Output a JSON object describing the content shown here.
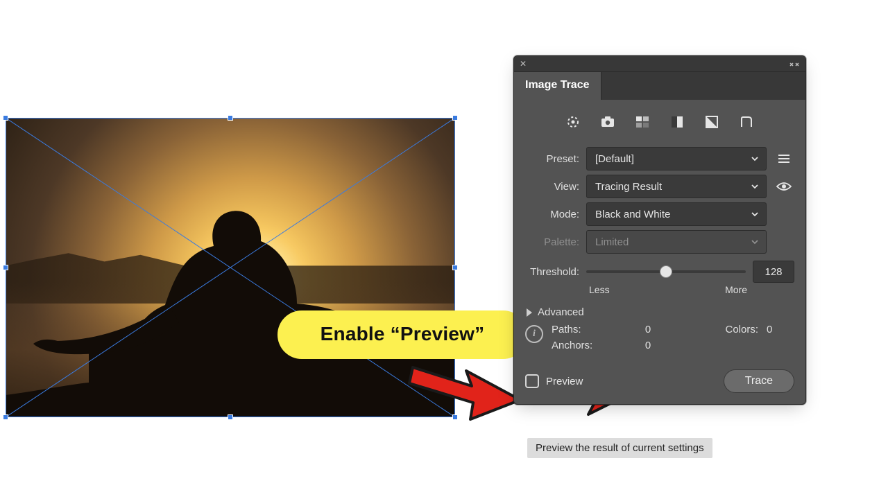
{
  "callout": {
    "text": "Enable “Preview”"
  },
  "panel": {
    "tab": "Image Trace",
    "preset": {
      "label": "Preset:",
      "value": "[Default]"
    },
    "view": {
      "label": "View:",
      "value": "Tracing Result"
    },
    "mode": {
      "label": "Mode:",
      "value": "Black and White"
    },
    "palette": {
      "label": "Palette:",
      "value": "Limited"
    },
    "threshold": {
      "label": "Threshold:",
      "value": "128",
      "min_label": "Less",
      "max_label": "More",
      "percent": 50
    },
    "advanced": "Advanced",
    "stats": {
      "paths_label": "Paths:",
      "paths_value": "0",
      "colors_label": "Colors:",
      "colors_value": "0",
      "anchors_label": "Anchors:",
      "anchors_value": "0"
    },
    "preview_label": "Preview",
    "trace_label": "Trace"
  },
  "tooltip": "Preview the result of current settings"
}
